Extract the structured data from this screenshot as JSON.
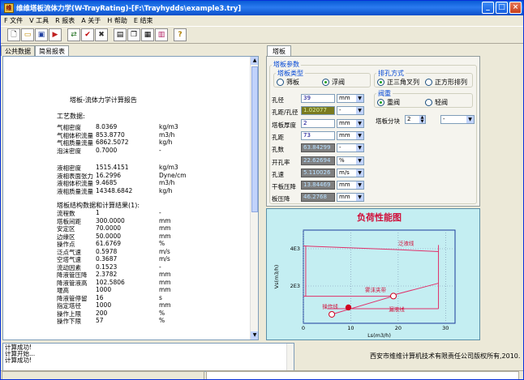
{
  "window": {
    "title": "维维塔板流体力学(W-TrayRating)-[F:\\Trayhydds\\example3.try]",
    "icon": "app-icon"
  },
  "menu": [
    "F 文件",
    "V 工具",
    "R 报表",
    "A 关于",
    "H 帮助",
    "E 结束"
  ],
  "toolbar": {
    "groups": [
      [
        "new-icon",
        "open-icon",
        "save-icon",
        "export-icon"
      ],
      [
        "calc-icon",
        "check-icon",
        "stop-icon"
      ],
      [
        "report-icon",
        "copy-icon",
        "print-icon",
        "chart-icon"
      ],
      [
        "help-icon"
      ]
    ],
    "help_label": "?"
  },
  "left_tabs": [
    "公共数据",
    "简易报表"
  ],
  "report": {
    "title": "塔板-流体力学计算报告",
    "sec1": "工艺数据:",
    "rows1": [
      [
        "气相密度",
        "8.0369",
        "kg/m3"
      ],
      [
        "气相体积流量",
        "853.8770",
        "m3/h"
      ],
      [
        "气相质量流量",
        "6862.5072",
        "kg/h"
      ],
      [
        "泡沫密度",
        "0.7000",
        "-"
      ]
    ],
    "rows2": [
      [
        "液相密度",
        "1515.4151",
        "kg/m3"
      ],
      [
        "液相表面张力",
        "16.2996",
        "Dyne/cm"
      ],
      [
        "液相体积流量",
        "9.4685",
        "m3/h"
      ],
      [
        "液相质量流量",
        "14348.6842",
        "kg/h"
      ]
    ],
    "sec2": "塔板结构数据和计算结果(1):",
    "rows3": [
      [
        "流程数",
        "1",
        "-"
      ],
      [
        "塔板间距",
        "300.0000",
        "mm"
      ],
      [
        "安定区",
        "70.0000",
        "mm"
      ],
      [
        "边缘区",
        "50.0000",
        "mm"
      ],
      [
        "操作点",
        "61.6769",
        "%"
      ],
      [
        "泛点气速",
        "0.5978",
        "m/s"
      ],
      [
        "空塔气速",
        "0.3687",
        "m/s"
      ],
      [
        "流动因素",
        "0.1523",
        "-"
      ],
      [
        "降液管压降",
        "2.3782",
        "mm"
      ],
      [
        "降液管液高",
        "102.5806",
        "mm"
      ],
      [
        "堰高",
        "1000",
        "mm"
      ],
      [
        "降液管停留",
        "16",
        "s"
      ],
      [
        "指定塔径",
        "1000",
        "mm"
      ],
      [
        "操作上限",
        "200",
        "%"
      ],
      [
        "操作下限",
        "57",
        "%"
      ]
    ]
  },
  "right_tab": "塔板",
  "panel": {
    "group_main": "塔板参数",
    "group_type": "塔板类型",
    "type_opts": [
      "筛板",
      "浮阀"
    ],
    "type_selected": 1,
    "group_hole": "排孔方式",
    "hole_opts": [
      "正三角叉列",
      "正方形排列"
    ],
    "group_valve": "阀重",
    "valve_opts": [
      "重阀",
      "轻阀"
    ],
    "fields": [
      {
        "label": "孔径",
        "value": "39",
        "unit": "mm"
      },
      {
        "label": "孔距/孔径",
        "value": "1.02077",
        "unit": "-"
      },
      {
        "label": "塔板厚度",
        "value": "2",
        "unit": "mm"
      },
      {
        "label": "孔距",
        "value": "73",
        "unit": "mm"
      },
      {
        "label": "孔数",
        "value": "63.84299",
        "unit": "-"
      },
      {
        "label": "开孔率",
        "value": "22.62694",
        "unit": "%"
      },
      {
        "label": "孔速",
        "value": "5.110026",
        "unit": "m/s"
      },
      {
        "label": "干板压降",
        "value": "13.84469",
        "unit": "mm"
      },
      {
        "label": "板压降",
        "value": "46.2768",
        "unit": "mm"
      }
    ],
    "tray_blocks_label": "塔板分块",
    "tray_blocks_value": "2",
    "tray_blocks_unit": "-"
  },
  "chart_data": {
    "type": "line",
    "title": "负荷性能图",
    "xlabel": "Ls(m3/h)",
    "ylabel": "Vs(m3/h)",
    "xlim": [
      0,
      32
    ],
    "ylim": [
      0,
      5000
    ],
    "xticks": [
      0,
      10,
      20,
      30
    ],
    "yticks": [
      {
        "v": 2000,
        "label": "2E3"
      },
      {
        "v": 4000,
        "label": "4E3"
      }
    ],
    "grid": true,
    "series": [
      {
        "name": "泛液线",
        "points": [
          [
            0,
            4150
          ],
          [
            10,
            4050
          ],
          [
            20,
            3950
          ],
          [
            28.5,
            3850
          ]
        ],
        "color": "#e0306a"
      },
      {
        "name": "雾沫夹带",
        "points": [
          [
            0,
            1450
          ],
          [
            18,
            1450
          ],
          [
            28.5,
            2150
          ]
        ],
        "color": "#e0306a"
      },
      {
        "name": "漏液线",
        "points": [
          [
            5,
            780
          ],
          [
            28.5,
            780
          ]
        ],
        "color": "#e0306a"
      },
      {
        "name": "操作线",
        "points": [
          [
            6,
            480
          ],
          [
            19,
            1460
          ]
        ],
        "color": "#e0306a"
      }
    ],
    "verticals": [
      {
        "x": 28.5,
        "y0": 780,
        "y1": 4200
      }
    ],
    "left_edge": {
      "x": 0.5,
      "y0": 1450,
      "y1": 4150
    },
    "points": [
      {
        "x": 6,
        "y": 480,
        "fill": "#ffffff"
      },
      {
        "x": 19,
        "y": 1460,
        "fill": "#ffffff"
      },
      {
        "x": 9.5,
        "y": 850,
        "fill": "#d00020"
      }
    ]
  },
  "log": [
    "计算成功!",
    "计算开始...",
    "计算成功!"
  ],
  "copyright": "西安市维维计算机技术有限责任公司版权所有,2010."
}
